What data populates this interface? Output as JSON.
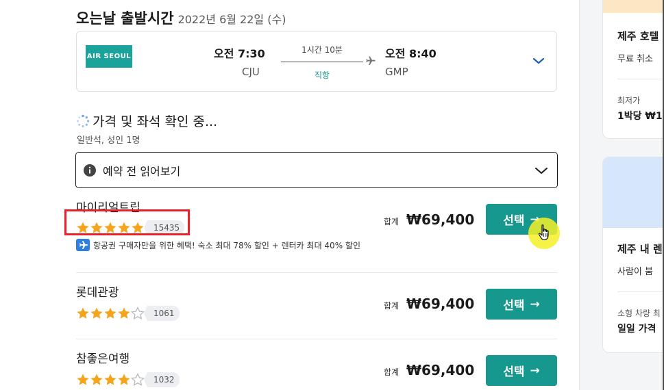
{
  "return_flight": {
    "title": "오는날 출발시간",
    "date": "2022년 6월 22일 (수)"
  },
  "flight": {
    "airline_logo_text": "AIR SEOUL",
    "departure_time": "오전 7:30",
    "departure_code": "CJU",
    "duration": "1시간 10분",
    "stop_type": "직항",
    "arrival_time": "오전 8:40",
    "arrival_code": "GMP"
  },
  "status": {
    "loading_text": "가격 및 좌석 확인 중...",
    "cabin_info": "일반석, 성인 1명"
  },
  "notice": {
    "label": "예약 전 읽어보기"
  },
  "agencies": [
    {
      "name": "마이리얼트립",
      "rating": 5,
      "reviews": "15435",
      "promo": "항공권 구매자만을 위한 혜택! 숙소 최대 78% 할인 + 렌터카 최대 40% 할인",
      "price_label": "합계",
      "price": "₩69,400",
      "select_label": "선택"
    },
    {
      "name": "롯데관광",
      "rating": 4,
      "reviews": "1061",
      "price_label": "합계",
      "price": "₩69,400",
      "select_label": "선택"
    },
    {
      "name": "참좋은여행",
      "rating": 4,
      "reviews": "1032",
      "price_label": "합계",
      "price": "₩69,400",
      "select_label": "선택"
    }
  ],
  "sidebar": {
    "card1": {
      "title": "제주 호텔",
      "subtitle": "무료 취소",
      "price_caption": "최저가",
      "price_line": "1박당 ₩1"
    },
    "card2": {
      "title": "제주 내 렌",
      "subtitle": "사람이 붐",
      "caption": "소형 차량 최",
      "bold_line": "일일 가격"
    }
  },
  "colors": {
    "accent": "#16988e",
    "star": "#f5a51d",
    "highlight": "#e8202c",
    "airline_brand": "#1aa39a"
  }
}
